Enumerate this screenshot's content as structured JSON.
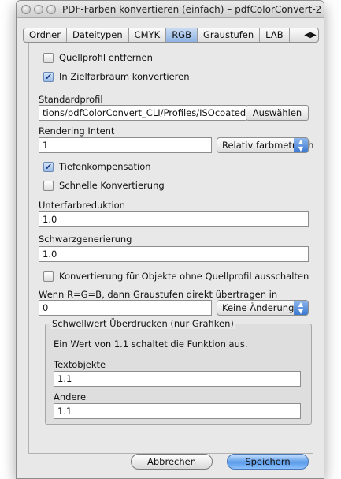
{
  "window": {
    "title": "PDF-Farben konvertieren (einfach) – pdfColorConvert-2..."
  },
  "tabs": {
    "items": [
      "Ordner",
      "Dateitypen",
      "CMYK",
      "RGB",
      "Graustufen",
      "LAB"
    ],
    "active": "RGB",
    "overflow_icon": "double-arrow-icon"
  },
  "form": {
    "remove_profile": {
      "label": "Quellprofil entfernen",
      "checked": false
    },
    "convert_target": {
      "label": "In Zielfarbraum konvertieren",
      "checked": true
    },
    "standard_profile": {
      "label": "Standardprofil",
      "value": "tions/pdfColorConvert_CLI/Profiles/ISOcoated",
      "button": "Auswählen"
    },
    "rendering_intent": {
      "label": "Rendering Intent",
      "value": "1",
      "popup": "Relativ farbmetrisch"
    },
    "depth_compensation": {
      "label": "Tiefenkompensation",
      "checked": true
    },
    "fast_conversion": {
      "label": "Schnelle Konvertierung",
      "checked": false
    },
    "ucr": {
      "label": "Unterfarbreduktion",
      "value": "1.0"
    },
    "gcr": {
      "label": "Schwarzgenerierung",
      "value": "1.0"
    },
    "disable_no_profile": {
      "label": "Konvertierung für Objekte ohne Quellprofil ausschalten",
      "checked": false
    },
    "gray_transfer": {
      "label": "Wenn R=G=B, dann Graustufen direkt übertragen in",
      "value": "0",
      "popup": "Keine Änderung"
    },
    "overprint_group": {
      "legend": "Schwellwert Überdrucken (nur Grafiken)",
      "info": "Ein Wert von 1.1 schaltet die Funktion aus.",
      "text_objects": {
        "label": "Textobjekte",
        "value": "1.1"
      },
      "other": {
        "label": "Andere",
        "value": "1.1"
      }
    }
  },
  "buttons": {
    "cancel": "Abbrechen",
    "save": "Speichern"
  },
  "colors": {
    "window_bg": "#e8e8e8",
    "accent_blue": "#5a9be8"
  }
}
